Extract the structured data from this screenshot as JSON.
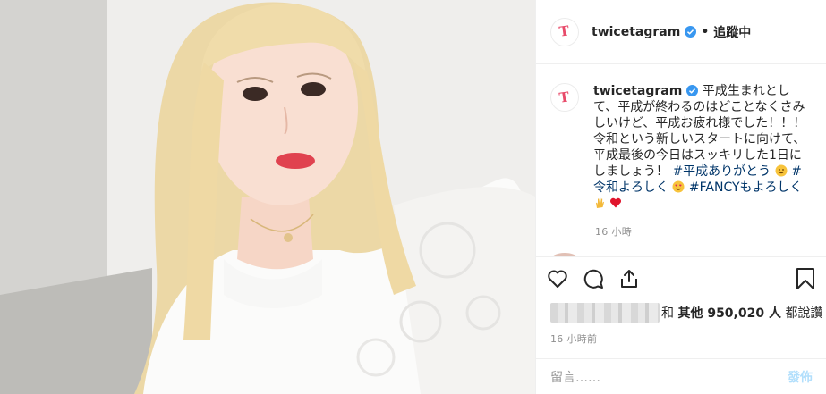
{
  "post": {
    "username": "twicetagram",
    "follow_state": "追蹤中",
    "separator": "•",
    "logo_text": "T",
    "caption_lines": [
      "平成生まれとして、",
      "平成が終わるのはどことなくさみし",
      "いけど、平成お疲れ様でした！！！",
      "令和という新しいスタートに向け",
      "て、平成最後の今日はスッキリした1",
      "日にしましょう！"
    ],
    "hashtags": [
      "#平成ありがとう",
      "#令和よろしく",
      "#FANCYもよろしく"
    ],
    "caption_time": "16 小時",
    "likes_prefix": "和 ",
    "likes_label": "其他 950,020 人",
    "likes_suffix": " 都說讚",
    "post_time": "16 小時前",
    "comment_placeholder": "留言……",
    "post_button": "發佈"
  },
  "icons": {
    "verified": "verified-badge-icon",
    "like": "heart-outline-icon",
    "comment": "comment-bubble-icon",
    "share": "share-arrow-icon",
    "save": "bookmark-icon"
  },
  "colors": {
    "verified": "#3897f0",
    "hashtag": "#003569",
    "logo": "#e84b6a",
    "post_button_disabled": "#b2dffc",
    "muted": "#8e8e8e"
  }
}
